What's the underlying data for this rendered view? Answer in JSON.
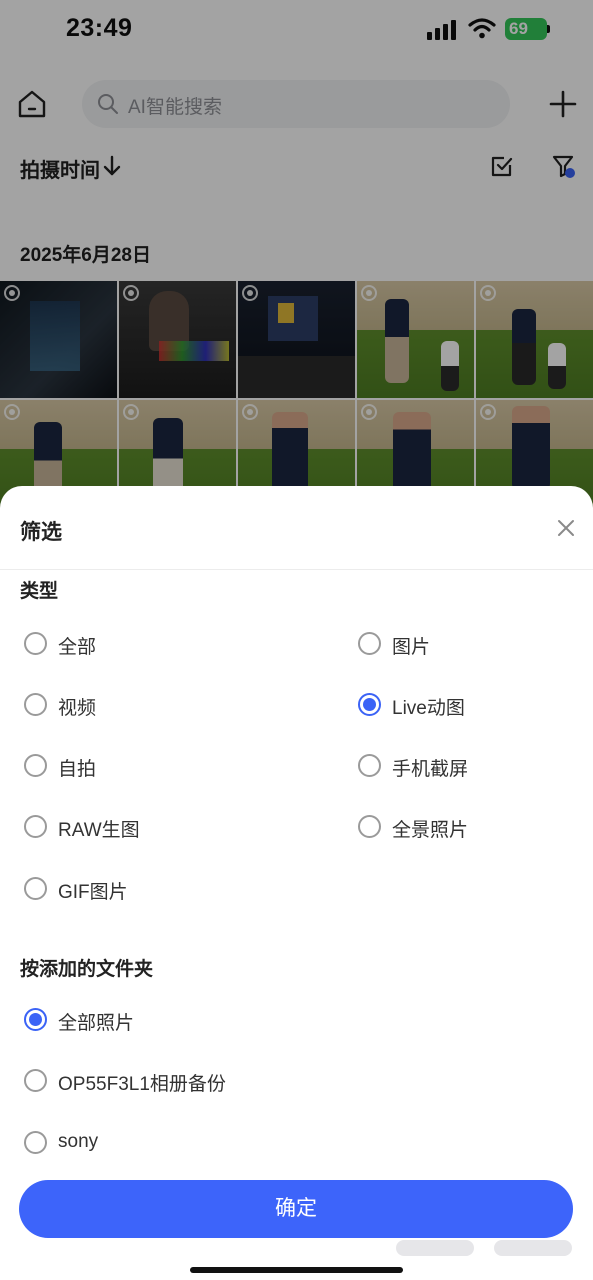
{
  "status_bar": {
    "time": "23:49",
    "battery": "69"
  },
  "header": {
    "search_placeholder": "AI智能搜索"
  },
  "sort": {
    "label": "拍摄时间"
  },
  "gallery": {
    "date_header": "2025年6月28日"
  },
  "filter_sheet": {
    "title": "筛选",
    "type_section": {
      "title": "类型",
      "options": [
        {
          "label": "全部",
          "selected": false
        },
        {
          "label": "图片",
          "selected": false
        },
        {
          "label": "视频",
          "selected": false
        },
        {
          "label": "Live动图",
          "selected": true
        },
        {
          "label": "自拍",
          "selected": false
        },
        {
          "label": "手机截屏",
          "selected": false
        },
        {
          "label": "RAW生图",
          "selected": false
        },
        {
          "label": "全景照片",
          "selected": false
        },
        {
          "label": "GIF图片",
          "selected": false
        }
      ]
    },
    "folder_section": {
      "title": "按添加的文件夹",
      "options": [
        {
          "label": "全部照片",
          "selected": true
        },
        {
          "label": "OP55F3L1相册备份",
          "selected": false
        },
        {
          "label": "sony",
          "selected": false
        }
      ]
    },
    "confirm_label": "确定"
  },
  "colors": {
    "accent": "#3d64fa",
    "battery": "#34c759"
  }
}
